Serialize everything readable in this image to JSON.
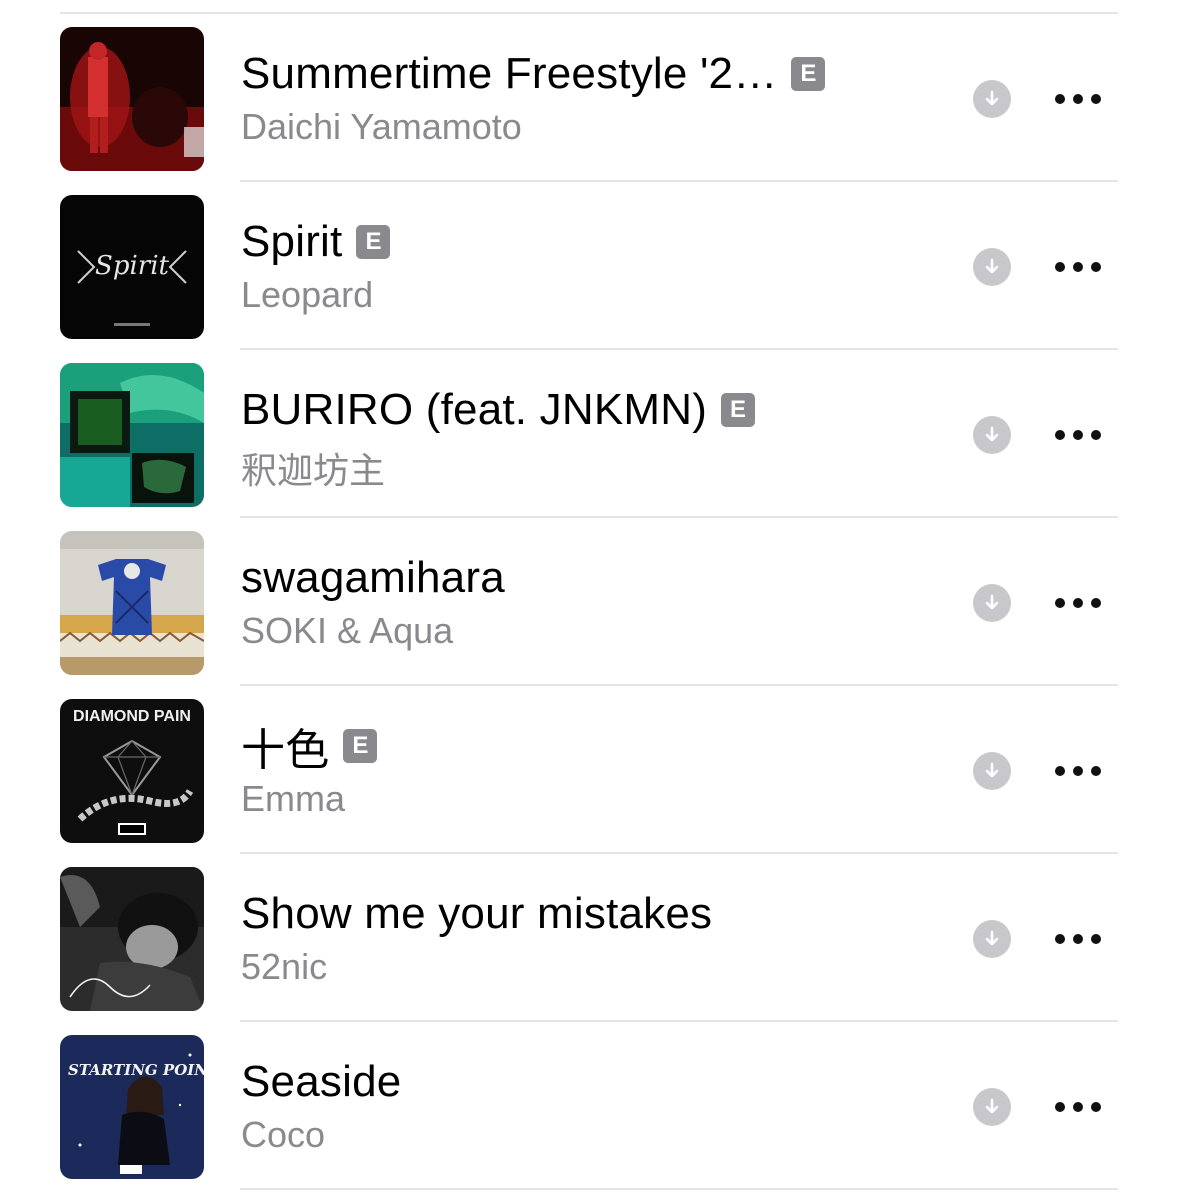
{
  "tracks": [
    {
      "title": "Summertime Freestyle '2…",
      "artist": "Daichi Yamamoto",
      "explicit": true,
      "explicit_label": "E",
      "art": "art-red-stage"
    },
    {
      "title": "Spirit",
      "artist": "Leopard",
      "explicit": true,
      "explicit_label": "E",
      "art": "art-black-logo",
      "art_text": "Spirit"
    },
    {
      "title": "BURIRO (feat. JNKMN)",
      "artist": "釈迦坊主",
      "explicit": true,
      "explicit_label": "E",
      "art": "art-green-collage"
    },
    {
      "title": "swagamihara",
      "artist": "SOKI & Aqua",
      "explicit": false,
      "explicit_label": "",
      "art": "art-kimono-wall"
    },
    {
      "title": "十色",
      "artist": "Emma",
      "explicit": true,
      "explicit_label": "E",
      "art": "art-diamond-pain",
      "art_text": "DIAMOND PAIN"
    },
    {
      "title": "Show me your mistakes",
      "artist": "52nic",
      "explicit": false,
      "explicit_label": "",
      "art": "art-bw-portrait"
    },
    {
      "title": "Seaside",
      "artist": "Coco",
      "explicit": false,
      "explicit_label": "",
      "art": "art-starting-point",
      "art_text": "STARTING POINT"
    }
  ],
  "colors": {
    "title": "#000000",
    "artist": "#8a8a8e",
    "badge": "#8a8a8e",
    "download": "#c7c7cc",
    "divider": "#e4e4e6"
  },
  "icons": {
    "download": "download-arrow-icon",
    "more": "ellipsis-icon"
  }
}
